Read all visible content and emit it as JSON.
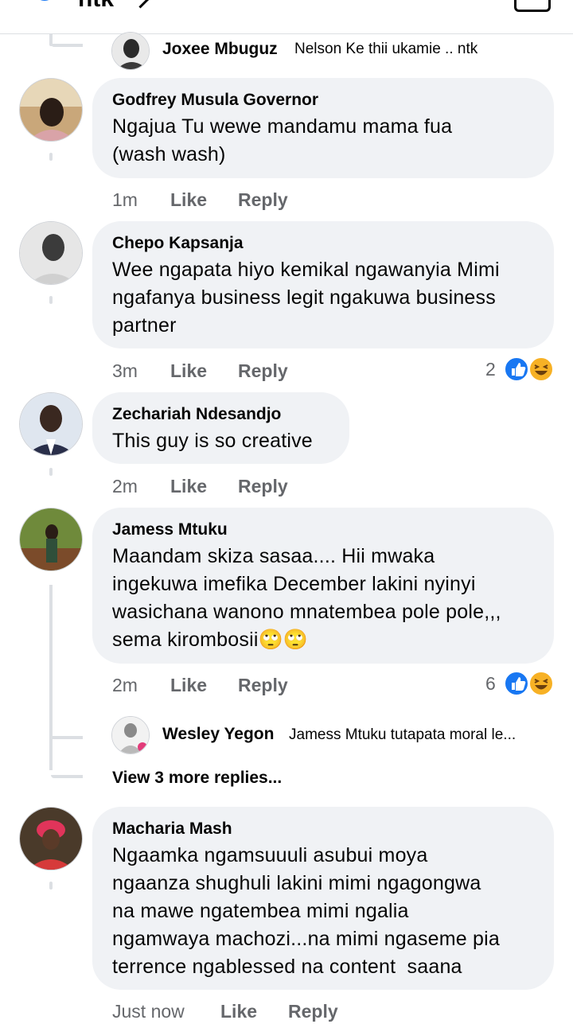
{
  "top": {
    "partial_text": "ntk"
  },
  "thread_reply_top": {
    "name": "Joxee Mbuguz",
    "text": "Nelson Ke thii ukamie .. ntk"
  },
  "comments": [
    {
      "name": "Godfrey Musula Governor",
      "lines": [
        "Ngajua Tu wewe mandamu mama fua",
        "(wash wash)"
      ],
      "time": "1m",
      "like": "Like",
      "reply": "Reply"
    },
    {
      "name": "Chepo Kapsanja",
      "lines": [
        "Wee ngapata hiyo kemikal ngawanyia Mimi",
        "ngafanya business legit ngakuwa business",
        "partner"
      ],
      "time": "3m",
      "like": "Like",
      "reply": "Reply",
      "reactions": "2"
    },
    {
      "name": "Zechariah Ndesandjo",
      "lines": [
        "This guy is so creative"
      ],
      "time": "2m",
      "like": "Like",
      "reply": "Reply"
    },
    {
      "name": "Jamess Mtuku",
      "lines": [
        "Maandam skiza sasaa.... Hii mwaka",
        "ingekuwa imefika December lakini nyinyi",
        "wasichana wanono mnatembea pole pole,,,",
        "sema kirombosii🙄🙄"
      ],
      "time": "2m",
      "like": "Like",
      "reply": "Reply",
      "reactions": "6"
    },
    {
      "name": "Macharia Mash",
      "lines": [
        "Ngaamka ngamsuuuli asubui moya",
        "ngaanza shughuli lakini mimi ngagongwa",
        "na mawe ngatembea mimi ngalia",
        "ngamwaya machozi...na mimi ngaseme pia",
        "terrence ngablessed na content  saana"
      ],
      "time": "Just now",
      "like": "Like",
      "reply": "Reply"
    }
  ],
  "nested_reply": {
    "name": "Wesley Yegon",
    "text": "Jamess Mtuku tutapata moral le..."
  },
  "view_more": "View 3 more replies...",
  "colors": {
    "bubble": "#f0f2f5",
    "meta": "#65676b",
    "like_blue": "#1877f2",
    "haha_yellow": "#f7b125"
  },
  "icons": [
    "like-reaction-icon",
    "haha-reaction-icon",
    "like-thumb-icon",
    "chevron-right-icon"
  ]
}
